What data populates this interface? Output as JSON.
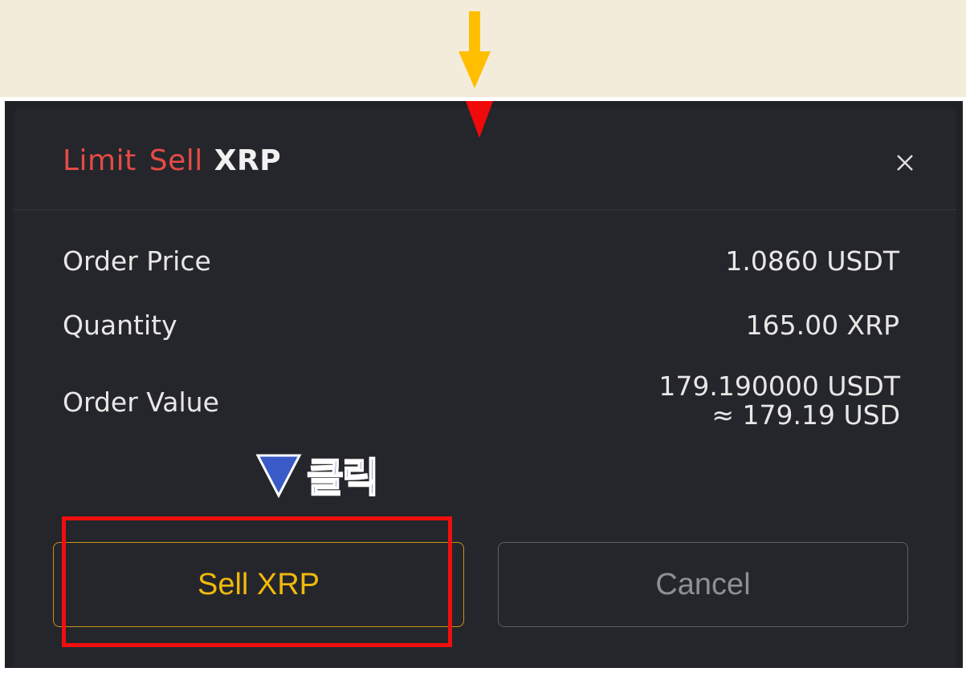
{
  "dialog": {
    "title_order_type": "Limit",
    "title_side": "Sell",
    "title_coin": "XRP",
    "close_icon": "close-icon"
  },
  "details": {
    "order_price_label": "Order Price",
    "order_price_value": "1.0860 USDT",
    "quantity_label": "Quantity",
    "quantity_value": "165.00 XRP",
    "order_value_label": "Order Value",
    "order_value_usdt": "179.190000 USDT",
    "order_value_usd": "≈ 179.19 USD"
  },
  "annotation": {
    "click_text": "클릭",
    "pointer_icon": "down-triangle-icon"
  },
  "buttons": {
    "sell_label": "Sell XRP",
    "cancel_label": "Cancel"
  },
  "colors": {
    "sell_red": "#e44b46",
    "sell_button_gold": "#f0b90b",
    "highlight_red": "#f00f0f",
    "arrow_yellow": "#ffbf00",
    "annotation_blue": "#3452b8",
    "top_band": "#f4ecda",
    "modal_bg": "#25262b"
  }
}
